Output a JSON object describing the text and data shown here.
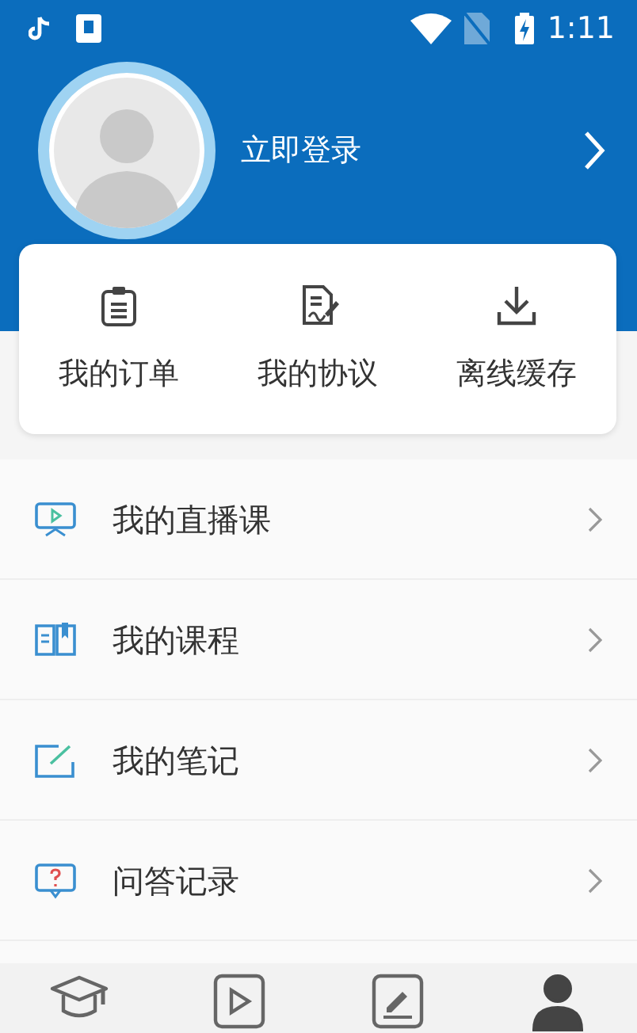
{
  "status_bar": {
    "time": "1:11"
  },
  "profile": {
    "login_text": "立即登录"
  },
  "shortcuts": [
    {
      "label": "我的订单",
      "kind": "orders"
    },
    {
      "label": "我的协议",
      "kind": "agreement"
    },
    {
      "label": "离线缓存",
      "kind": "download"
    }
  ],
  "menu": [
    {
      "label": "我的直播课",
      "kind": "live"
    },
    {
      "label": "我的课程",
      "kind": "course"
    },
    {
      "label": "我的笔记",
      "kind": "notes"
    },
    {
      "label": "问答记录",
      "kind": "qa"
    }
  ],
  "tab_bar": [
    {
      "kind": "school",
      "selected": false
    },
    {
      "kind": "video",
      "selected": false
    },
    {
      "kind": "exam",
      "selected": false
    },
    {
      "kind": "profile",
      "selected": true
    }
  ]
}
